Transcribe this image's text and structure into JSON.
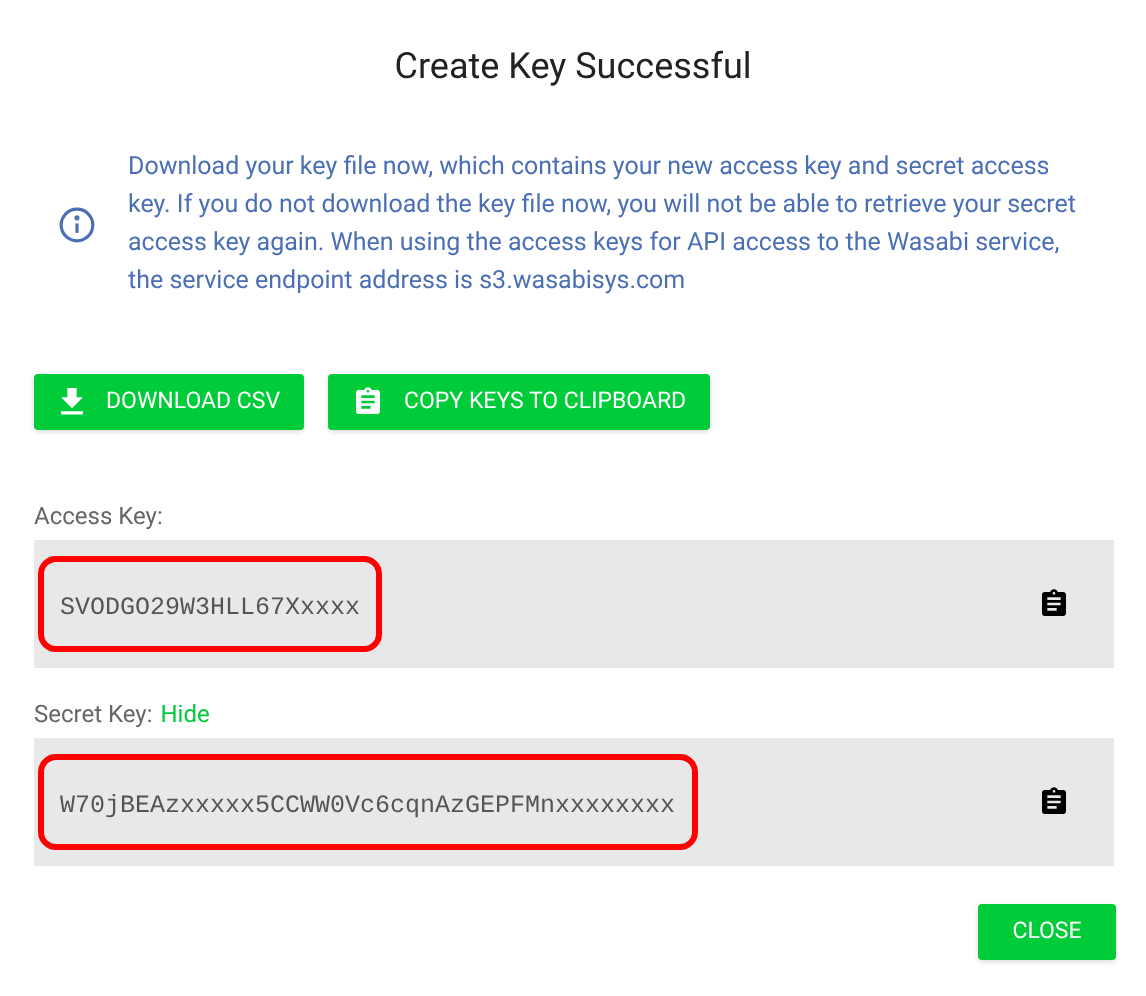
{
  "title": "Create Key Successful",
  "info": "Download your key file now, which contains your new access key and secret access key. If you do not download the key file now, you will not be able to retrieve your secret access key again. When using the access keys for API access to the Wasabi service, the service endpoint address is s3.wasabisys.com",
  "actions": [
    {
      "label": "DOWNLOAD CSV",
      "kind": "download"
    },
    {
      "label": "COPY KEYS TO CLIPBOARD",
      "kind": "clipboard"
    }
  ],
  "keys": [
    {
      "label": "Access Key:",
      "value": "SVODGO29W3HLL67Xxxxx",
      "highlighted": true
    },
    {
      "label": "Secret Key:",
      "link": "Hide",
      "value": "W70jBEAzxxxxx5CCWW0Vc6cqnAzGEPFMnxxxxxxxx",
      "highlighted": true
    }
  ],
  "close_button": "CLOSE"
}
